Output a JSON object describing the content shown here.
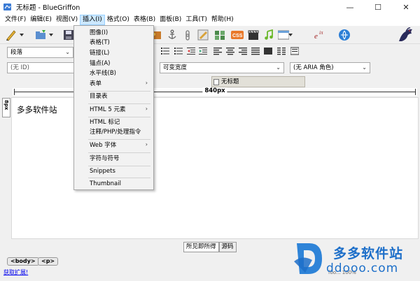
{
  "window": {
    "title": "无标题 - BlueGriffon",
    "controls": {
      "minimize": "—",
      "maximize": "☐",
      "close": "✕"
    }
  },
  "menubar": {
    "items": [
      "文件(F)",
      "编辑(E)",
      "视图(V)",
      "插入(I)",
      "格式(O)",
      "表格(B)",
      "面板(B)",
      "工具(T)",
      "帮助(H)"
    ],
    "active_index": 3
  },
  "insert_menu": {
    "items": [
      {
        "label": "图像(I)",
        "submenu": false
      },
      {
        "label": "表格(T)",
        "submenu": false
      },
      {
        "label": "链接(L)",
        "submenu": false
      },
      {
        "label": "锚点(A)",
        "submenu": false
      },
      {
        "label": "水平线(B)",
        "submenu": false
      },
      {
        "label": "表单",
        "submenu": true
      },
      {
        "label": "目录表",
        "submenu": false
      },
      {
        "label": "HTML 5 元素",
        "submenu": true
      },
      {
        "label": "HTML 标记",
        "submenu": false
      },
      {
        "label": "注释/PHP/处理指令",
        "submenu": false
      },
      {
        "label": "Web 字体",
        "submenu": true
      },
      {
        "label": "字符与符号",
        "submenu": false
      },
      {
        "label": "Snippets",
        "submenu": false
      },
      {
        "label": "Thumbnail",
        "submenu": false
      }
    ],
    "submenu_arrow": "›"
  },
  "format_toolbar": {
    "paragraph_select": "段落",
    "id_select": "(无 ID)",
    "width_select": "可变宽度",
    "aria_select": "(无 ARIA 角色)"
  },
  "document_tab": {
    "label": "无标题"
  },
  "ruler": {
    "width_label": "840px"
  },
  "vertical_ruler": {
    "label": "8px"
  },
  "editor": {
    "content": "多多软件站"
  },
  "view_toggle": {
    "wysiwyg": "所见即所得",
    "source": "源码"
  },
  "breadcrumbs": [
    "<body>",
    "<p>"
  ],
  "status": {
    "extensions_link": "获取扩展!",
    "footer_text": "foo...  100%"
  },
  "watermark": {
    "name": "多多软件站",
    "url": "ddooo.com"
  },
  "colors": {
    "accent": "#1d6fc9",
    "menu_highlight": "#cce8ff"
  }
}
